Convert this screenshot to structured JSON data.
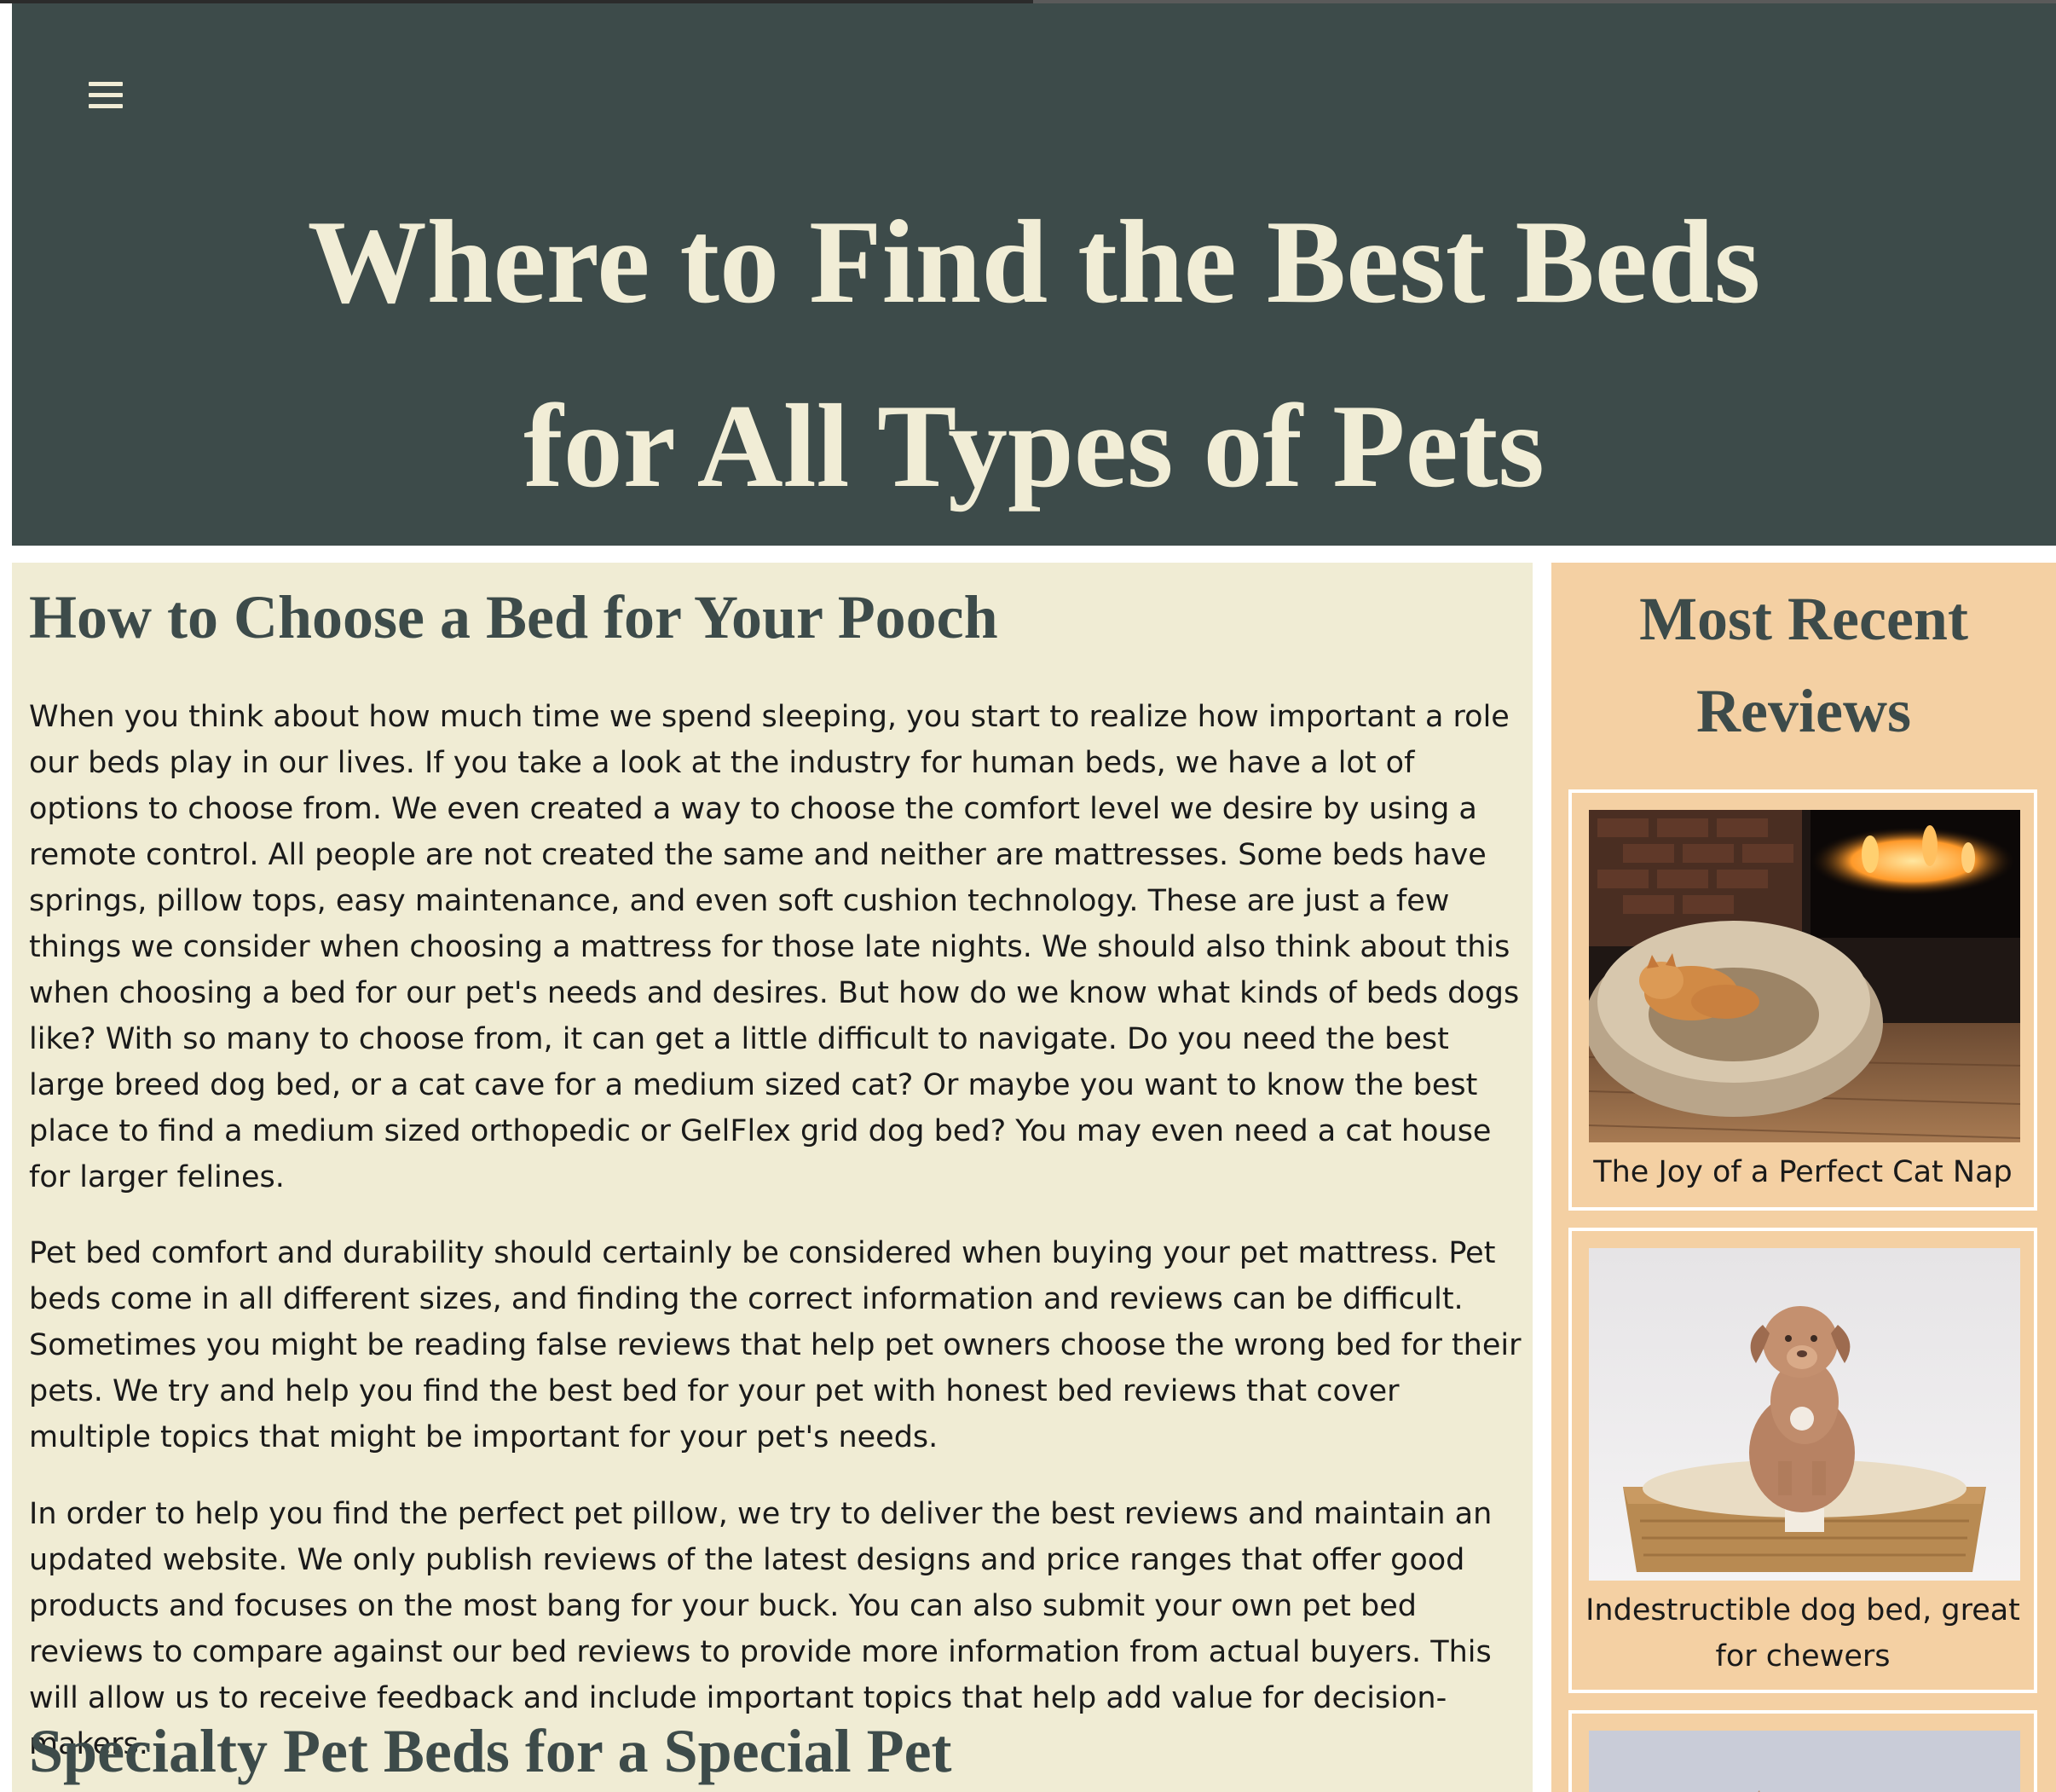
{
  "header": {
    "title_line1": "Where to Find the Best Beds",
    "title_line2": "for All Types of Pets",
    "menu_icon": "hamburger-menu-icon"
  },
  "main": {
    "heading1": "How to Choose a Bed for Your Pooch",
    "paragraphs": [
      "When you think about how much time we spend sleeping, you start to realize how important a role our beds play in our lives. If you take a look at the industry for human beds, we have a lot of options to choose from. We even created a way to choose the comfort level we desire by using a remote control. All people are not created the same and neither are mattresses. Some beds have springs, pillow tops, easy maintenance, and even soft cushion technology. These are just a few things we consider when choosing a mattress for those late nights. We should also think about this when choosing a bed for our pet's needs and desires. But how do we know what kinds of beds dogs like? With so many to choose from, it can get a little difficult to navigate. Do you need the best large breed dog bed, or a cat cave for a medium sized cat? Or maybe you want to know the best place to find a medium sized orthopedic or GelFlex grid dog bed? You may even need a cat house for larger felines.",
      "Pet bed comfort and durability should certainly be considered when buying your pet mattress. Pet beds come in all different sizes, and finding the correct information and reviews can be difficult. Sometimes you might be reading false reviews that help pet owners choose the wrong bed for their pets. We try and help you find the best bed for your pet with honest bed reviews that cover multiple topics that might be important for your pet's needs.",
      "In order to help you find the perfect pet pillow, we try to deliver the best reviews and maintain an updated website. We only publish reviews of the latest designs and price ranges that offer good products and focuses on the most bang for your buck. You can also submit your own pet bed reviews to compare against our bed reviews to provide more information from actual buyers. This will allow us to receive feedback and include important topics that help add value for decision-makers."
    ],
    "heading2": "Specialty Pet Beds for a Special Pet"
  },
  "sidebar": {
    "title": "Most Recent Reviews",
    "reviews": [
      {
        "caption": "The Joy of a Perfect Cat Nap",
        "image": "cat-sleeping-in-fluffy-bed-photo"
      },
      {
        "caption": "Indestructible dog bed, great for chewers",
        "image": "puppy-on-woven-basket-bed-photo"
      },
      {
        "caption": "",
        "image": "partial-review-photo"
      }
    ]
  },
  "colors": {
    "header_bg": "#3d4b4a",
    "title_text": "#f1edd6",
    "main_bg": "#f0ecd4",
    "sidebar_bg": "#f4d0a3",
    "heading_text": "#3d4b4a"
  }
}
